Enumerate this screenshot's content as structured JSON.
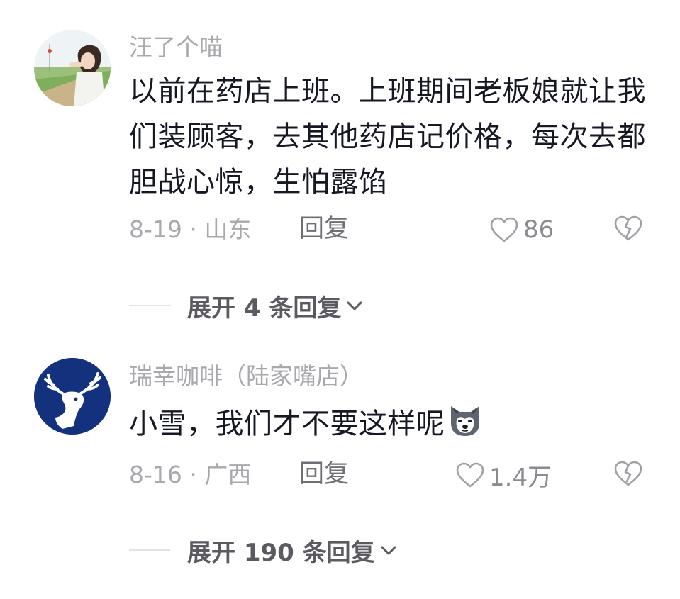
{
  "comments": [
    {
      "username": "汪了个喵",
      "text": "以前在药店上班。上班期间老板娘就让我们装顾客，去其他药店记价格，每次去都胆战心惊，生怕露馅",
      "date_location": "8-19 · 山东",
      "reply_label": "回复",
      "likes": "86",
      "expand_label": "展开 4 条回复"
    },
    {
      "username": "瑞幸咖啡（陆家嘴店）",
      "text": "小雪，我们才不要这样呢",
      "emoji": "husky-dog-emoji",
      "date_location": "8-16 · 广西",
      "reply_label": "回复",
      "likes": "1.4万",
      "expand_label": "展开 190 条回复"
    }
  ],
  "colors": {
    "luckin_blue": "#13317d",
    "secondary_text": "#a8a8ad",
    "body_text": "#161823"
  }
}
